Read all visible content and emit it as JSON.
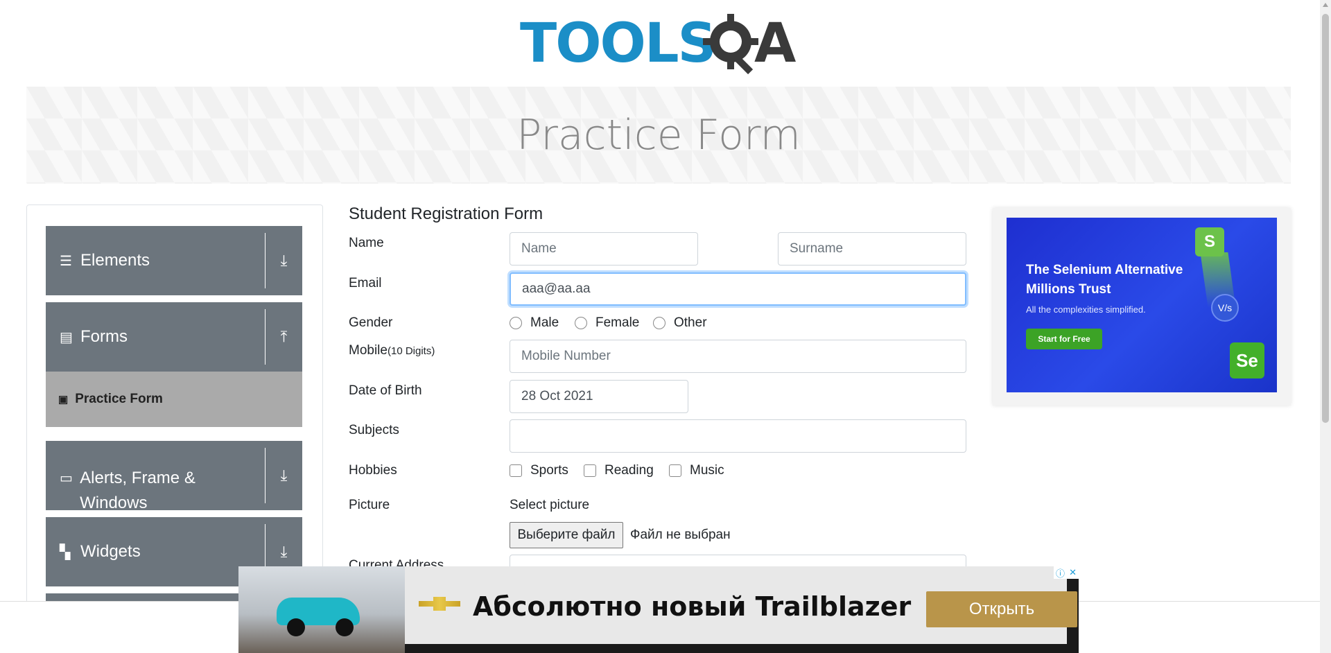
{
  "logo": {
    "brand_left": "TOOLS",
    "brand_right": "QA"
  },
  "banner": {
    "title": "Practice Form"
  },
  "sidebar": {
    "groups": [
      {
        "label": "Elements",
        "icon": "hamburger-icon",
        "toggle": "download-arrow-icon"
      },
      {
        "label": "Forms",
        "icon": "document-icon",
        "toggle": "upload-arrow-icon"
      },
      {
        "label": "Alerts, Frame & Windows",
        "icon": "window-icon",
        "toggle": "download-arrow-icon"
      },
      {
        "label": "Widgets",
        "icon": "widgets-icon",
        "toggle": "download-arrow-icon"
      }
    ],
    "active_item": "Practice Form"
  },
  "form": {
    "title": "Student Registration Form",
    "name_label": "Name",
    "first_name_placeholder": "Name",
    "last_name_placeholder": "Surname",
    "email_label": "Email",
    "email_value": "aaa@aa.aa",
    "gender_label": "Gender",
    "gender_options": [
      "Male",
      "Female",
      "Other"
    ],
    "mobile_label": "Mobile",
    "mobile_hint": "(10 Digits)",
    "mobile_placeholder": "Mobile Number",
    "dob_label": "Date of Birth",
    "dob_value": "28 Oct 2021",
    "subjects_label": "Subjects",
    "hobbies_label": "Hobbies",
    "hobbies_options": [
      "Sports",
      "Reading",
      "Music"
    ],
    "picture_label": "Picture",
    "picture_select": "Select picture",
    "file_button": "Выберите файл",
    "file_status": "Файл не выбран",
    "address_label": "Current Address"
  },
  "ad_right": {
    "headline": "The Selenium Alternative Millions Trust",
    "sub": "All the complexities simplified.",
    "cta": "Start for Free",
    "badge_s": "S",
    "badge_vs": "V/s",
    "badge_se": "Se"
  },
  "ad_bottom": {
    "headline": "Абсолютно новый Trailblazer",
    "button": "Открыть",
    "info_icon": "info-icon",
    "close_icon": "close-icon"
  },
  "colors": {
    "sidebar": "#6c757d",
    "active": "#aaaaaa",
    "focus": "#80bdff",
    "brand_blue": "#1b8ec7"
  }
}
